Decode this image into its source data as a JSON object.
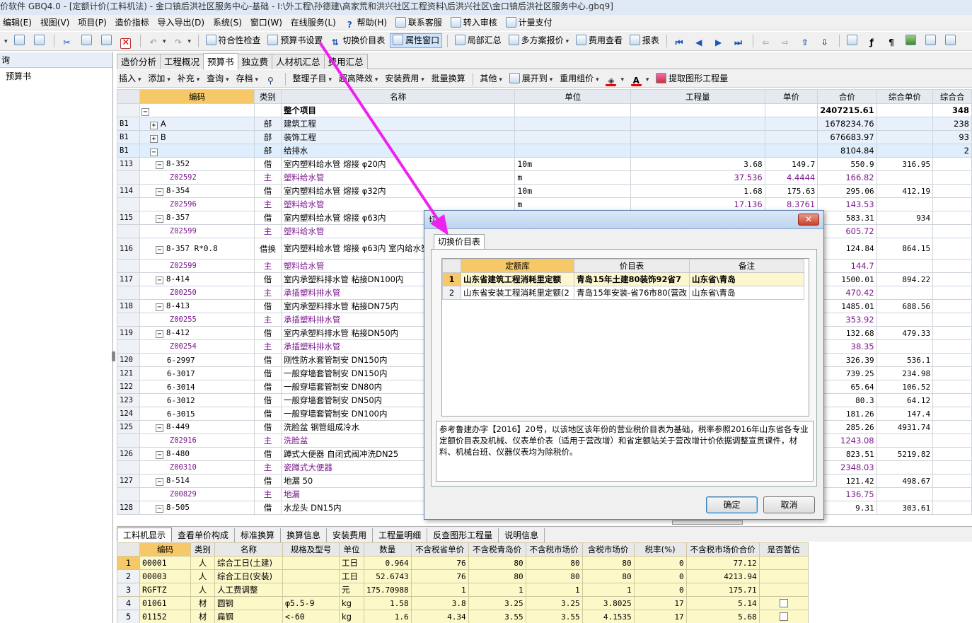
{
  "window": {
    "title": "价软件 GBQ4.0 - [定额计价(工料机法) - 金口镇后洪社区服务中心-基础 - I:\\外工程\\孙德建\\高家荒和洪兴社区工程资料\\后洪兴社区\\金口镇后洪社区服务中心.gbq9]"
  },
  "menu": [
    "编辑(E)",
    "视图(V)",
    "项目(P)",
    "造价指标",
    "导入导出(D)",
    "系统(S)",
    "窗口(W)",
    "在线服务(L)",
    "帮助(H)",
    "联系客服",
    "转入审核",
    "计量支付"
  ],
  "toolbar": {
    "compliance_check": "符合性检查",
    "budget_settings": "预算书设置",
    "switch_price_list": "切换价目表",
    "property_window": "属性窗口",
    "partial_summary": "局部汇总",
    "multi_quote": "多方案报价",
    "fee_view": "费用查看",
    "report": "报表"
  },
  "left_panel": {
    "header": "询",
    "item": "预算书"
  },
  "tabs": [
    "造价分析",
    "工程概况",
    "预算书",
    "独立费",
    "人材机汇总",
    "费用汇总"
  ],
  "active_tab": "预算书",
  "toolbar2": [
    "插入",
    "添加",
    "补充",
    "查询",
    "存档",
    "整理子目",
    "超高降效",
    "安装费用",
    "批量换算",
    "其他",
    "展开到",
    "重用组价",
    "提取图形工程量"
  ],
  "grid": {
    "columns": [
      "编码",
      "类别",
      "名称",
      "单位",
      "工程量",
      "单价",
      "合价",
      "综合单价",
      "综合合"
    ],
    "rows": [
      {
        "hdr": "",
        "code": "",
        "type": "",
        "name": "整个项目",
        "unit": "",
        "qty": "",
        "price": "",
        "total": "2407215.61",
        "uprice": "",
        "utotal": "348",
        "kind": "top"
      },
      {
        "hdr": "B1",
        "code": "A",
        "type": "部",
        "name": "建筑工程",
        "unit": "",
        "qty": "",
        "price": "",
        "total": "1678234.76",
        "uprice": "",
        "utotal": "238",
        "kind": "band"
      },
      {
        "hdr": "B1",
        "code": "B",
        "type": "部",
        "name": "装饰工程",
        "unit": "",
        "qty": "",
        "price": "",
        "total": "676683.97",
        "uprice": "",
        "utotal": "93",
        "kind": "band"
      },
      {
        "hdr": "B1",
        "code": "",
        "type": "部",
        "name": "给排水",
        "unit": "",
        "qty": "",
        "price": "",
        "total": "8104.84",
        "uprice": "",
        "utotal": "2",
        "kind": "sel"
      },
      {
        "hdr": "113",
        "code": "8-352",
        "type": "借",
        "name": "室内塑料给水管 熔接 φ20内",
        "unit": "10m",
        "qty": "3.68",
        "price": "149.7",
        "total": "550.9",
        "uprice": "316.95",
        "utotal": "",
        "kind": "main"
      },
      {
        "hdr": "",
        "code": "Z02592",
        "type": "主",
        "name": "塑料给水管",
        "unit": "m",
        "qty": "37.536",
        "price": "4.4444",
        "total": "166.82",
        "uprice": "",
        "utotal": "",
        "kind": "mat"
      },
      {
        "hdr": "114",
        "code": "8-354",
        "type": "借",
        "name": "室内塑料给水管 熔接 φ32内",
        "unit": "10m",
        "qty": "1.68",
        "price": "175.63",
        "total": "295.06",
        "uprice": "412.19",
        "utotal": "",
        "kind": "main"
      },
      {
        "hdr": "",
        "code": "Z02596",
        "type": "主",
        "name": "塑料给水管",
        "unit": "m",
        "qty": "17.136",
        "price": "8.3761",
        "total": "143.53",
        "uprice": "",
        "utotal": "",
        "kind": "mat"
      },
      {
        "hdr": "115",
        "code": "8-357",
        "type": "借",
        "name": "室内塑料给水管 熔接 φ63内",
        "unit": "",
        "qty": "",
        "price": "",
        "total": "583.31",
        "uprice": "934",
        "utotal": "",
        "kind": "main"
      },
      {
        "hdr": "",
        "code": "Z02599",
        "type": "主",
        "name": "塑料给水管",
        "unit": "",
        "qty": "",
        "price": "",
        "total": "605.72",
        "uprice": "",
        "utotal": "",
        "kind": "mat"
      },
      {
        "hdr": "116",
        "code": "8-357 R*0.8",
        "type": "借换",
        "name": "室内塑料给水管 熔接 φ63内 室内给水塑料管道暗敷时",
        "unit": "",
        "qty": "",
        "price": "",
        "total": "124.84",
        "uprice": "864.15",
        "utotal": "",
        "kind": "main tall"
      },
      {
        "hdr": "",
        "code": "Z02599",
        "type": "主",
        "name": "塑料给水管",
        "unit": "",
        "qty": "",
        "price": "",
        "total": "144.7",
        "uprice": "",
        "utotal": "",
        "kind": "mat"
      },
      {
        "hdr": "117",
        "code": "8-414",
        "type": "借",
        "name": "室内承塑料排水管 粘接DN100内",
        "unit": "",
        "qty": "",
        "price": "",
        "total": "1500.01",
        "uprice": "894.22",
        "utotal": "",
        "kind": "main"
      },
      {
        "hdr": "",
        "code": "Z00250",
        "type": "主",
        "name": "承插塑料排水管",
        "unit": "",
        "qty": "",
        "price": "",
        "total": "470.42",
        "uprice": "",
        "utotal": "",
        "kind": "mat"
      },
      {
        "hdr": "118",
        "code": "8-413",
        "type": "借",
        "name": "室内承塑料排水管 粘接DN75内",
        "unit": "",
        "qty": "",
        "price": "",
        "total": "1485.01",
        "uprice": "688.56",
        "utotal": "",
        "kind": "main"
      },
      {
        "hdr": "",
        "code": "Z00255",
        "type": "主",
        "name": "承插塑料排水管",
        "unit": "",
        "qty": "",
        "price": "",
        "total": "353.92",
        "uprice": "",
        "utotal": "",
        "kind": "mat"
      },
      {
        "hdr": "119",
        "code": "8-412",
        "type": "借",
        "name": "室内承塑料排水管 粘接DN50内",
        "unit": "",
        "qty": "",
        "price": "",
        "total": "132.68",
        "uprice": "479.33",
        "utotal": "",
        "kind": "main"
      },
      {
        "hdr": "",
        "code": "Z00254",
        "type": "主",
        "name": "承插塑料排水管",
        "unit": "",
        "qty": "",
        "price": "",
        "total": "38.35",
        "uprice": "",
        "utotal": "",
        "kind": "mat"
      },
      {
        "hdr": "120",
        "code": "6-2997",
        "type": "借",
        "name": "刚性防水套管制安 DN150内",
        "unit": "",
        "qty": "",
        "price": "",
        "total": "326.39",
        "uprice": "536.1",
        "utotal": "",
        "kind": "main leaf"
      },
      {
        "hdr": "121",
        "code": "6-3017",
        "type": "借",
        "name": "一般穿墙套管制安 DN150内",
        "unit": "",
        "qty": "",
        "price": "",
        "total": "739.25",
        "uprice": "234.98",
        "utotal": "",
        "kind": "main leaf"
      },
      {
        "hdr": "122",
        "code": "6-3014",
        "type": "借",
        "name": "一般穿墙套管制安 DN80内",
        "unit": "",
        "qty": "",
        "price": "",
        "total": "65.64",
        "uprice": "106.52",
        "utotal": "",
        "kind": "main leaf"
      },
      {
        "hdr": "123",
        "code": "6-3012",
        "type": "借",
        "name": "一般穿墙套管制安 DN50内",
        "unit": "",
        "qty": "",
        "price": "",
        "total": "80.3",
        "uprice": "64.12",
        "utotal": "",
        "kind": "main leaf"
      },
      {
        "hdr": "124",
        "code": "6-3015",
        "type": "借",
        "name": "一般穿墙套管制安 DN100内",
        "unit": "",
        "qty": "",
        "price": "",
        "total": "181.26",
        "uprice": "147.4",
        "utotal": "",
        "kind": "main leaf"
      },
      {
        "hdr": "125",
        "code": "8-449",
        "type": "借",
        "name": "洗脸盆 钢管组成冷水",
        "unit": "",
        "qty": "",
        "price": "",
        "total": "285.26",
        "uprice": "4931.74",
        "utotal": "",
        "kind": "main"
      },
      {
        "hdr": "",
        "code": "Z02916",
        "type": "主",
        "name": "洗脸盆",
        "unit": "",
        "qty": "",
        "price": "",
        "total": "1243.08",
        "uprice": "",
        "utotal": "",
        "kind": "mat"
      },
      {
        "hdr": "126",
        "code": "8-480",
        "type": "借",
        "name": "蹲式大便器 自闭式阀冲洗DN25",
        "unit": "",
        "qty": "",
        "price": "",
        "total": "823.51",
        "uprice": "5219.82",
        "utotal": "",
        "kind": "main"
      },
      {
        "hdr": "",
        "code": "Z00310",
        "type": "主",
        "name": "瓷蹲式大便器",
        "unit": "",
        "qty": "",
        "price": "",
        "total": "2348.03",
        "uprice": "",
        "utotal": "",
        "kind": "mat"
      },
      {
        "hdr": "127",
        "code": "8-514",
        "type": "借",
        "name": "地漏 50",
        "unit": "",
        "qty": "",
        "price": "",
        "total": "121.42",
        "uprice": "498.67",
        "utotal": "",
        "kind": "main"
      },
      {
        "hdr": "",
        "code": "Z00829",
        "type": "主",
        "name": "地漏",
        "unit": "",
        "qty": "",
        "price": "",
        "total": "136.75",
        "uprice": "",
        "utotal": "",
        "kind": "mat"
      },
      {
        "hdr": "128",
        "code": "8-505",
        "type": "借",
        "name": "水龙头 DN15内",
        "unit": "",
        "qty": "",
        "price": "",
        "total": "9.31",
        "uprice": "303.61",
        "utotal": "",
        "kind": "main"
      }
    ]
  },
  "bottom_tabs": [
    "工料机显示",
    "查看单价构成",
    "标准换算",
    "换算信息",
    "安装费用",
    "工程量明细",
    "反查图形工程量",
    "说明信息"
  ],
  "subgrid": {
    "columns": [
      "编码",
      "类别",
      "名称",
      "规格及型号",
      "单位",
      "数量",
      "不含税省单价",
      "不含税青岛价",
      "不含税市场价",
      "含税市场价",
      "税率(%)",
      "不含税市场价合价",
      "是否暂估"
    ],
    "rows": [
      {
        "n": "1",
        "code": "00001",
        "type": "人",
        "name": "综合工日(土建)",
        "spec": "",
        "unit": "工日",
        "qty": "0.964",
        "p1": "76",
        "p2": "80",
        "p3": "80",
        "p4": "80",
        "tax": "0",
        "sum": "77.12",
        "cb": false
      },
      {
        "n": "2",
        "code": "00003",
        "type": "人",
        "name": "综合工日(安装)",
        "spec": "",
        "unit": "工日",
        "qty": "52.6743",
        "p1": "76",
        "p2": "80",
        "p3": "80",
        "p4": "80",
        "tax": "0",
        "sum": "4213.94",
        "cb": false
      },
      {
        "n": "3",
        "code": "RGFTZ",
        "type": "人",
        "name": "人工费调整",
        "spec": "",
        "unit": "元",
        "qty": "175.70988",
        "p1": "1",
        "p2": "1",
        "p3": "1",
        "p4": "1",
        "tax": "0",
        "sum": "175.71",
        "cb": false
      },
      {
        "n": "4",
        "code": "01061",
        "type": "材",
        "name": "圆钢",
        "spec": "φ5.5-9",
        "unit": "kg",
        "qty": "1.58",
        "p1": "3.8",
        "p2": "3.25",
        "p3": "3.25",
        "p4": "3.8025",
        "tax": "17",
        "sum": "5.14",
        "cb": true
      },
      {
        "n": "5",
        "code": "01152",
        "type": "材",
        "name": "扁钢",
        "spec": "<-60",
        "unit": "kg",
        "qty": "1.6",
        "p1": "4.34",
        "p2": "3.55",
        "p3": "3.55",
        "p4": "4.1535",
        "tax": "17",
        "sum": "5.68",
        "cb": true
      }
    ]
  },
  "dialog": {
    "title": "切",
    "tab": "切换价目表",
    "columns": [
      "定额库",
      "价目表",
      "备注"
    ],
    "rows": [
      {
        "n": "1",
        "lib": "山东省建筑工程消耗里定额",
        "price": "青岛15年土建80装饰92省7",
        "note": "山东省\\青岛"
      },
      {
        "n": "2",
        "lib": "山东省安装工程消耗里定额(2",
        "price": "青岛15年安装-省76市80(营改",
        "note": "山东省\\青岛"
      }
    ],
    "note": "参考鲁建办字【2016】20号，以该地区该年份的营业税价目表为基础，税率参照2016年山东省各专业定额价目表及机械、仪表单价表（适用于营改增）和省定额站关于营改增计价依据调整宣贯课件，材料、机械台班、仪器仪表均为除税价。",
    "ok": "确定",
    "cancel": "取消",
    "close": "✕"
  },
  "colors": {
    "accent_orange": "#f6c867",
    "material_purple": "#7a1a8c",
    "arrow_magenta": "#ee22ee",
    "subgrid_yellow": "#fdf8c8"
  }
}
